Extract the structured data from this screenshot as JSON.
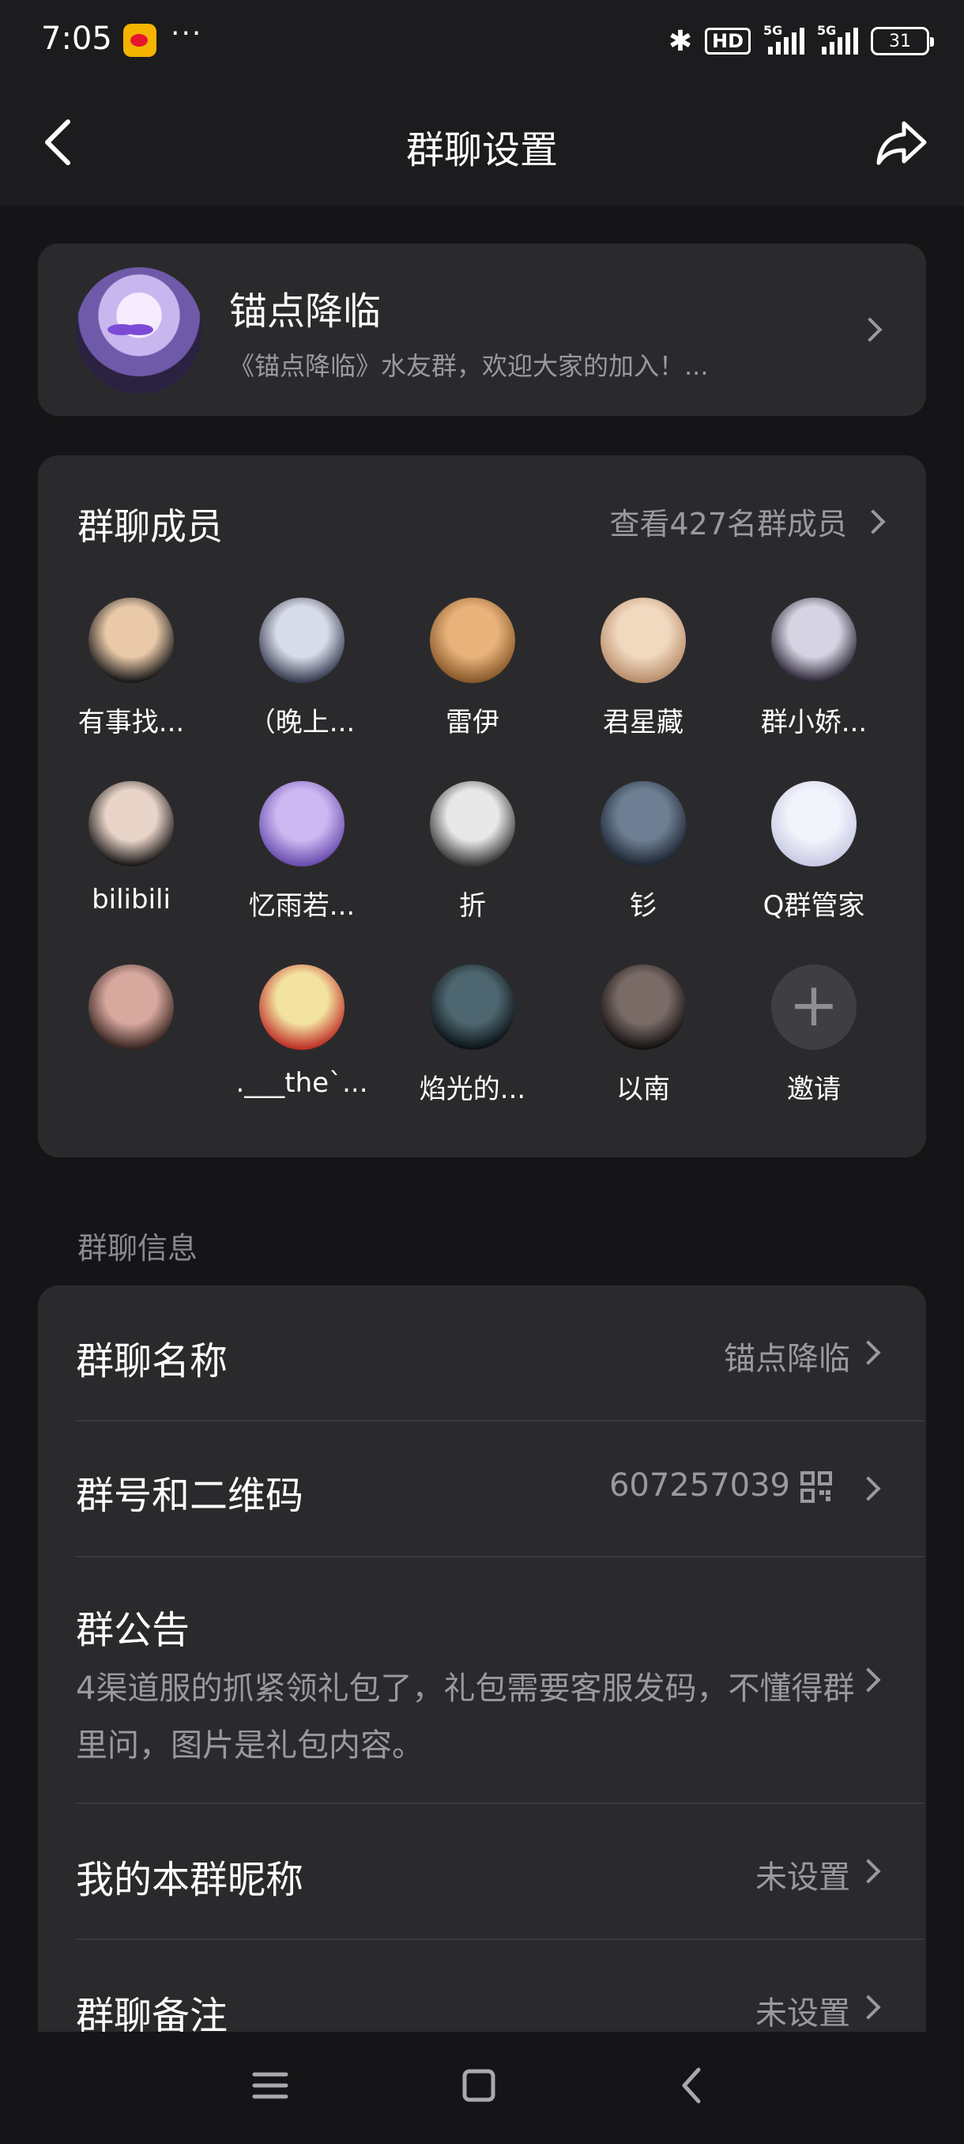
{
  "status_bar": {
    "time": "7:05",
    "network_label": "5G",
    "hd_label": "HD",
    "battery": "31"
  },
  "nav": {
    "title": "群聊设置",
    "back_icon": "chevron-left-icon",
    "share_icon": "share-arrow-icon"
  },
  "group": {
    "name": "锚点降临",
    "description": "《锚点降临》水友群，欢迎大家的加入！..."
  },
  "members": {
    "title": "群聊成员",
    "view_all_label": "查看427名群成员",
    "list": [
      {
        "name": "有事找...",
        "colors": [
          "#e9c9a8",
          "#1a1a1a"
        ]
      },
      {
        "name": "（晚上...",
        "colors": [
          "#d8dce8",
          "#3b3f54"
        ]
      },
      {
        "name": "雷伊",
        "colors": [
          "#e8b27a",
          "#8a5a2c"
        ]
      },
      {
        "name": "君星藏",
        "colors": [
          "#f1d9c0",
          "#b98f6c"
        ]
      },
      {
        "name": "群小娇...",
        "colors": [
          "#d6d3e2",
          "#2b2636"
        ]
      },
      {
        "name": "bilibili",
        "colors": [
          "#e8d4c8",
          "#1d1a1a"
        ]
      },
      {
        "name": "忆雨若...",
        "colors": [
          "#cdb8f2",
          "#6b4fae"
        ]
      },
      {
        "name": "折",
        "colors": [
          "#e8e8e8",
          "#3a3a3a"
        ]
      },
      {
        "name": "钐",
        "colors": [
          "#6e7f93",
          "#1f2835"
        ]
      },
      {
        "name": "Q群管家",
        "colors": [
          "#f2f3fb",
          "#c9cbe4"
        ]
      },
      {
        "name": "",
        "colors": [
          "#d7a89e",
          "#3a2622"
        ]
      },
      {
        "name": ".___the`...",
        "colors": [
          "#f3e3a0",
          "#c0312a"
        ]
      },
      {
        "name": "焰光的...",
        "colors": [
          "#4e6670",
          "#0d1418"
        ]
      },
      {
        "name": "以南",
        "colors": [
          "#7a6b66",
          "#151212"
        ]
      }
    ],
    "invite_label": "邀请"
  },
  "info_section": {
    "label": "群聊信息",
    "rows": {
      "name": {
        "label": "群聊名称",
        "value": "锚点降临"
      },
      "number": {
        "label": "群号和二维码",
        "value": "607257039"
      },
      "notice": {
        "label": "群公告",
        "text": "4渠道服的抓紧领礼包了，礼包需要客服发码，不懂得群里问，图片是礼包内容。"
      },
      "nickname": {
        "label": "我的本群昵称",
        "value": "未设置"
      },
      "remark": {
        "label": "群聊备注",
        "value": "未设置"
      }
    }
  }
}
